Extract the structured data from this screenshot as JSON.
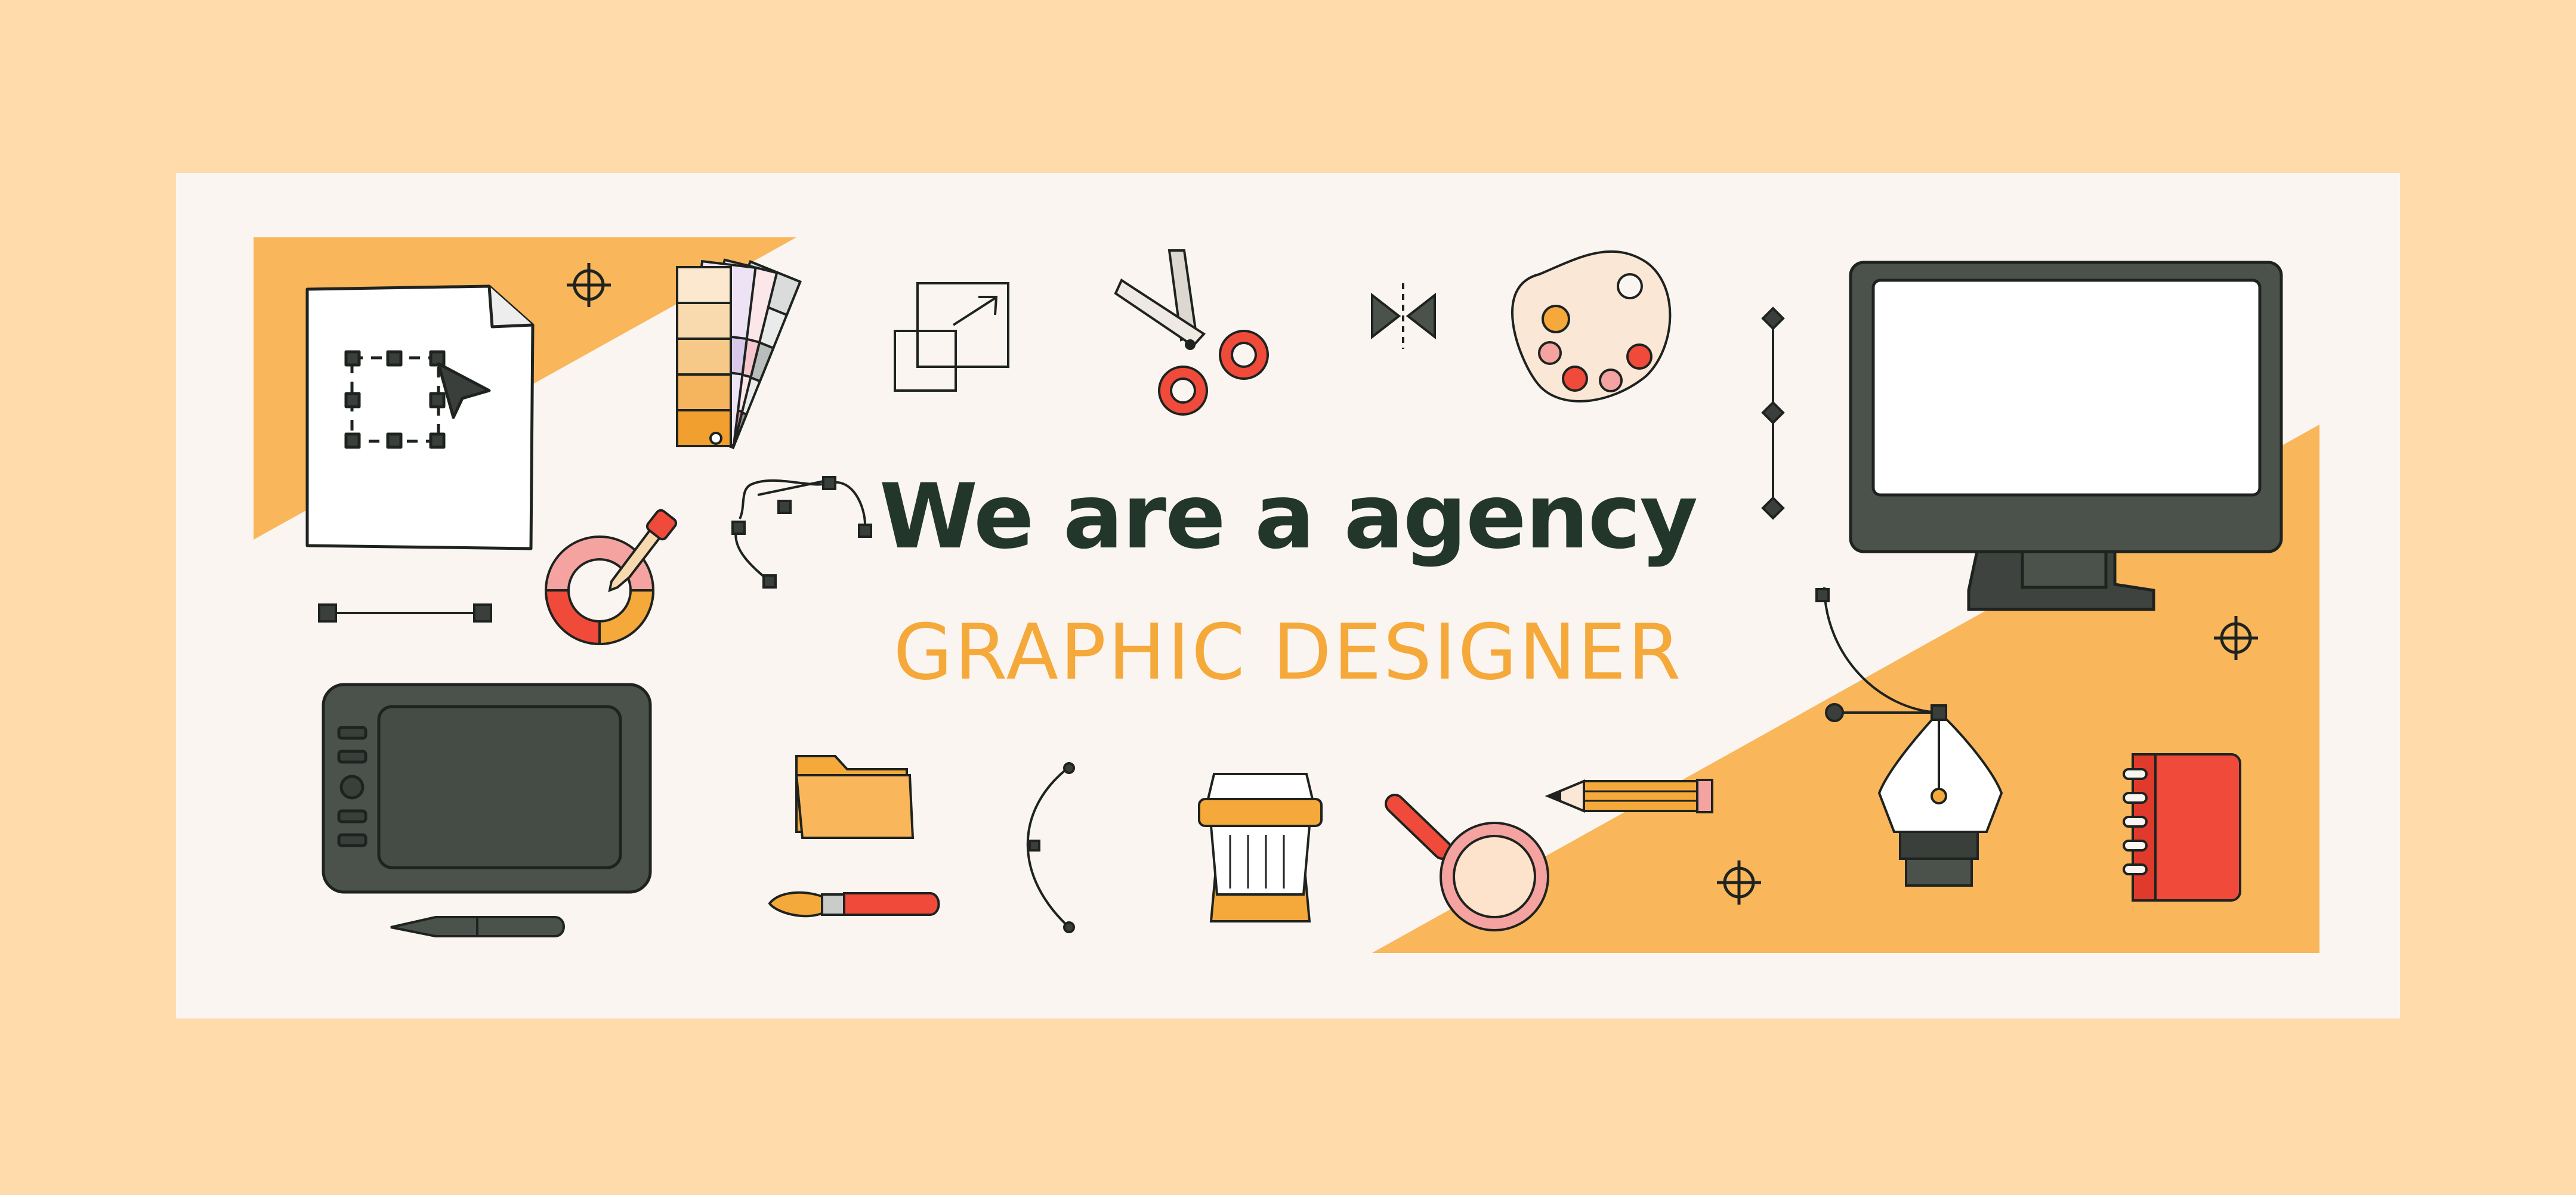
{
  "banner": {
    "headline": "We are a agency",
    "subheadline": "GRAPHIC DESIGNER"
  },
  "colors": {
    "outer_background": "#FFDBAB",
    "card_background": "#FAF5F0",
    "accent_orange": "#F9B65A",
    "headline_text": "#22362C",
    "subheadline_text": "#F5A93A",
    "device_dark": "#4B524B",
    "accent_red": "#F04A3A",
    "accent_pink": "#F5A3A0",
    "outline": "#1E2320"
  },
  "illustrations": [
    "document-select-icon",
    "color-swatch-fan-icon",
    "resize-icon",
    "scissors-icon",
    "bowtie-icon",
    "paint-palette-icon",
    "vertical-guide-icon",
    "monitor-icon",
    "crosshair-icon",
    "bezier-curve-icon",
    "eyedropper-color-wheel-icon",
    "line-segment-icon",
    "graphics-tablet-icon",
    "stylus-pen-icon",
    "folder-icon",
    "paintbrush-icon",
    "arc-curve-icon",
    "coffee-cup-icon",
    "magnifier-icon",
    "pencil-icon",
    "pen-tool-nib-icon",
    "notebook-icon"
  ]
}
